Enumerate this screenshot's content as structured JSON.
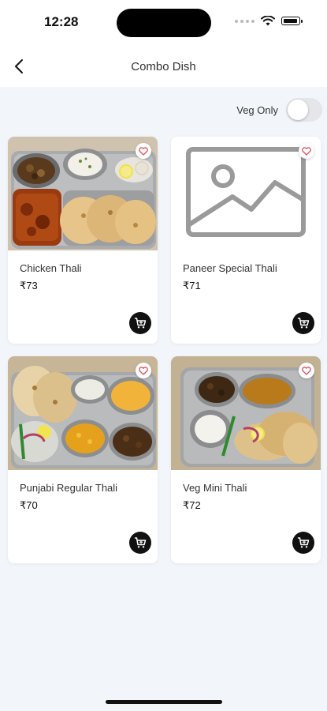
{
  "status_bar": {
    "time": "12:28"
  },
  "header": {
    "title": "Combo Dish"
  },
  "filter": {
    "veg_only_label": "Veg Only",
    "veg_only_enabled": false
  },
  "products": [
    {
      "name": "Chicken Thali",
      "price": "₹73",
      "image": "chicken-thali-photo"
    },
    {
      "name": "Paneer Special Thali",
      "price": "₹71",
      "image": "image-placeholder-icon"
    },
    {
      "name": "Punjabi Regular Thali",
      "price": "₹70",
      "image": "punjabi-thali-photo"
    },
    {
      "name": "Veg Mini Thali",
      "price": "₹72",
      "image": "veg-mini-thali-photo"
    }
  ],
  "icons": {
    "back": "chevron-left-icon",
    "favorite": "heart-icon",
    "cart": "cart-icon"
  },
  "colors": {
    "background": "#f2f5fa",
    "accent": "#111111",
    "heart": "#e0505a"
  }
}
